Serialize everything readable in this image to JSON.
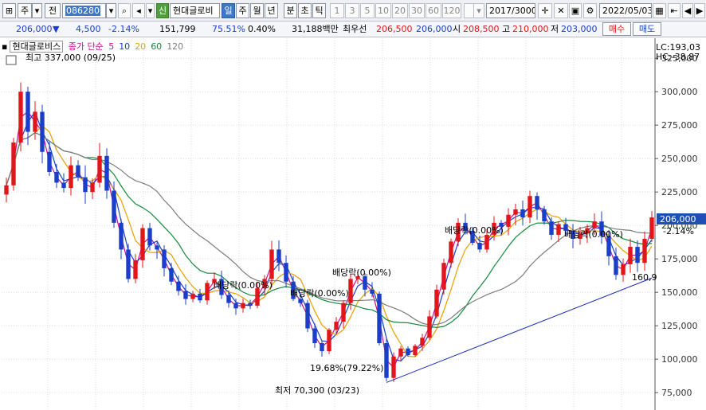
{
  "toolbar": {
    "mode_label": "주",
    "prev_label": "전",
    "code": "086280",
    "sin_label": "신",
    "name": "현대글로비",
    "periods": [
      "일",
      "주",
      "월",
      "년",
      "분",
      "초",
      "틱"
    ],
    "active_period": "일",
    "intervals": [
      "1",
      "3",
      "5",
      "10",
      "20",
      "30",
      "60",
      "120"
    ],
    "count": "2017",
    "count_total": "/3000",
    "date": "2022/05/03"
  },
  "quote": {
    "price": "206,000",
    "change": "4,500",
    "change_pct": "-2.14%",
    "volume": "151,799",
    "vol_ratio": "75.51%",
    "turnover": "0.40%",
    "amount": "31,188백만",
    "best_label": "최우선",
    "best_bid": "206,500",
    "best_ask": "206,000",
    "open_label": "시",
    "open": "208,500",
    "high_label": "고",
    "high": "210,000",
    "low_label": "저",
    "low": "203,000",
    "buy_label": "매수",
    "sell_label": "매도"
  },
  "legend": {
    "name": "현대글로비스",
    "price_label": "종가 단순",
    "ma": [
      "5",
      "10",
      "20",
      "60",
      "120"
    ],
    "ma_colors": [
      "#c8108c",
      "#1a3ec8",
      "#e7a000",
      "#138a3a",
      "#7d7d7d"
    ]
  },
  "annotations": {
    "high": "최고 337,000 (09/25)",
    "low": "최저 70,300 (03/23)",
    "ratio": "19.68%(79.22%)",
    "dividends": [
      "배당락(0.00%)",
      "배당락(0.00%)",
      "배당락(0.00%)",
      "배당락(0.00%)",
      "배당락(0.00%)"
    ],
    "trend_value": "160,9",
    "lc": "LC:193,03",
    "hc": "HC:-38,87",
    "current_price": "206,000",
    "current_pct": "-2.14%"
  },
  "chart_data": {
    "type": "candlestick",
    "y_ticks": [
      75000,
      100000,
      125000,
      150000,
      175000,
      200000,
      225000,
      250000,
      275000,
      300000,
      325000
    ],
    "ylim": [
      62000,
      340000
    ],
    "closes": [
      230000,
      262000,
      300000,
      270000,
      285000,
      255000,
      240000,
      232000,
      228000,
      245000,
      236000,
      225000,
      232000,
      252000,
      226000,
      202000,
      182000,
      160000,
      174000,
      198000,
      185000,
      182000,
      168000,
      158000,
      151000,
      145000,
      149000,
      144000,
      157000,
      160000,
      148000,
      142000,
      138000,
      142000,
      140000,
      153000,
      160000,
      182000,
      172000,
      158000,
      145000,
      142000,
      123000,
      112000,
      106000,
      122000,
      128000,
      142000,
      160000,
      162000,
      152000,
      149000,
      112000,
      86000,
      102000,
      108000,
      103000,
      110000,
      116000,
      132000,
      152000,
      172000,
      188000,
      202000,
      196000,
      187000,
      182000,
      193000,
      202000,
      199000,
      208000,
      212000,
      206000,
      222000,
      212000,
      203000,
      193000,
      201000,
      196000,
      190000,
      194000,
      198000,
      203000,
      192000,
      177000,
      163000,
      171000,
      184000,
      172000,
      190000,
      206000
    ]
  }
}
